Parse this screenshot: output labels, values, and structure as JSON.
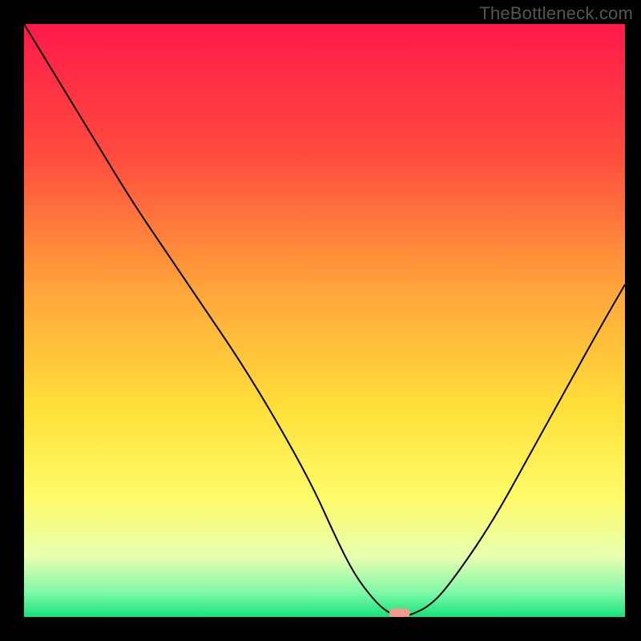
{
  "watermark": "TheBottleneck.com",
  "chart_data": {
    "type": "line",
    "title": "",
    "xlabel": "",
    "ylabel": "",
    "xlim": [
      0,
      100
    ],
    "ylim": [
      0,
      100
    ],
    "grid": false,
    "background": "vertical-gradient",
    "gradient_stops": [
      {
        "pos": 0.0,
        "color": "#ff1a4a"
      },
      {
        "pos": 0.22,
        "color": "#ff4b3e"
      },
      {
        "pos": 0.45,
        "color": "#ffa63a"
      },
      {
        "pos": 0.65,
        "color": "#ffe03a"
      },
      {
        "pos": 0.8,
        "color": "#fffb6a"
      },
      {
        "pos": 0.9,
        "color": "#e6ffb0"
      },
      {
        "pos": 0.96,
        "color": "#7cf8a8"
      },
      {
        "pos": 1.0,
        "color": "#16e27a"
      }
    ],
    "series": [
      {
        "name": "bottleneck-curve",
        "x": [
          0,
          6,
          12,
          18,
          24,
          30,
          36,
          42,
          48,
          52,
          55,
          58,
          60,
          62,
          64,
          68,
          72,
          78,
          84,
          90,
          96,
          100
        ],
        "y": [
          100,
          90,
          80,
          70,
          61,
          52,
          43,
          33,
          22,
          13,
          7,
          3,
          1,
          0,
          0,
          2,
          7,
          16,
          27,
          38,
          49,
          56
        ]
      }
    ],
    "markers": [
      {
        "name": "optimal-point",
        "x": 62.5,
        "y": 0.5,
        "shape": "pill",
        "color": "#f2998e"
      }
    ]
  }
}
